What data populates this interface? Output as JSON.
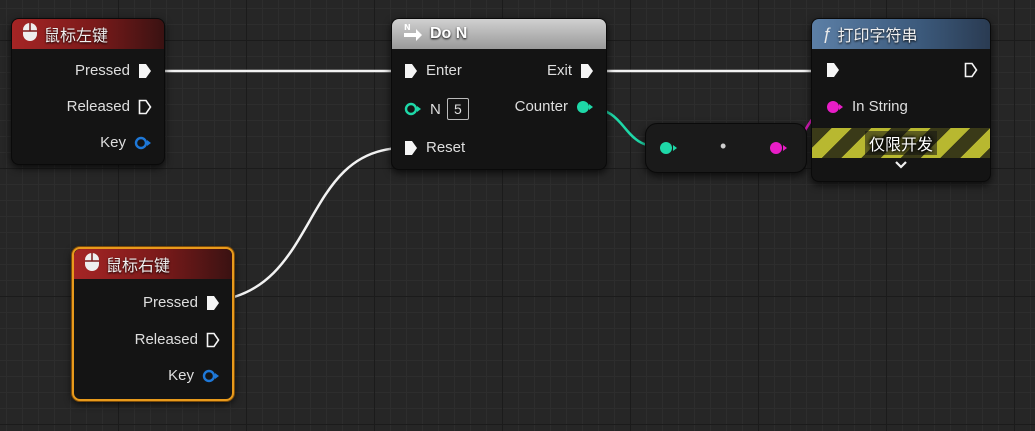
{
  "colors": {
    "exec": "#f5f5f5",
    "int_pin": "#1ed8a8",
    "string_pin": "#e81dc7",
    "struct_pin": "#1e78d8",
    "selected_border": "#e89a1c"
  },
  "nodes": {
    "left_mouse": {
      "title": "鼠标左键",
      "icon": "mouse-icon",
      "pins": {
        "pressed": "Pressed",
        "released": "Released",
        "key": "Key"
      }
    },
    "right_mouse": {
      "title": "鼠标右键",
      "icon": "mouse-icon",
      "pins": {
        "pressed": "Pressed",
        "released": "Released",
        "key": "Key"
      }
    },
    "do_n": {
      "title": "Do N",
      "icon": "do-n-icon",
      "pins": {
        "enter": "Enter",
        "n": "N",
        "n_value": "5",
        "reset": "Reset",
        "exit": "Exit",
        "counter": "Counter"
      }
    },
    "print_string": {
      "title": "打印字符串",
      "icon": "function-icon",
      "icon_glyph": "ƒ",
      "pins": {
        "in_string": "In String"
      },
      "dev_only": "仅限开发",
      "expand_icon": "chevron-down-icon"
    },
    "conversion": {
      "type": "int-to-string-conversion",
      "dot": "•"
    }
  }
}
